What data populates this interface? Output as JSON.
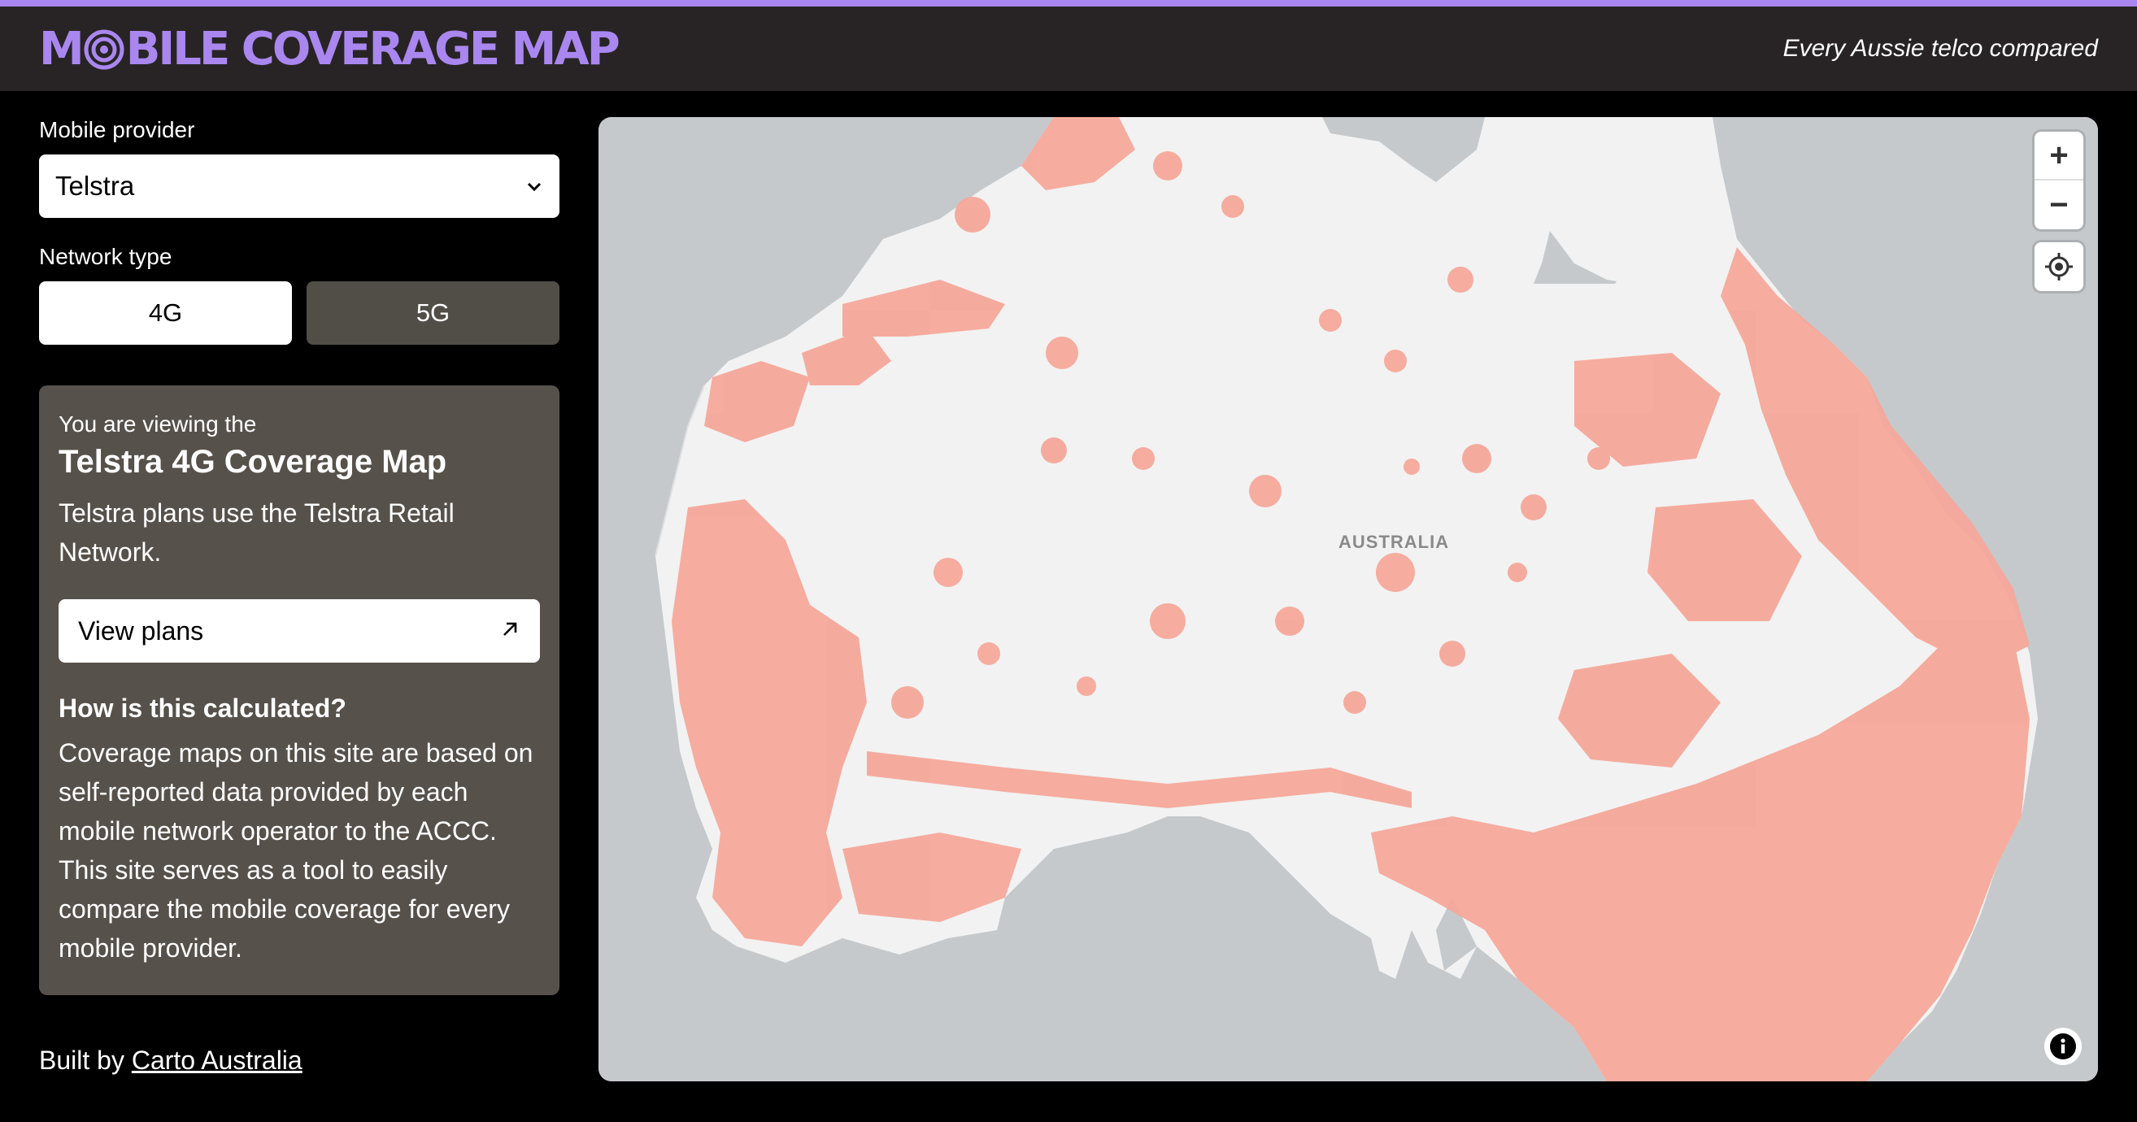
{
  "header": {
    "logo_text_before": "M",
    "logo_text_after": "BILE COVERAGE MAP",
    "tagline": "Every Aussie telco compared",
    "accent_color": "#a987ef"
  },
  "sidebar": {
    "provider_label": "Mobile provider",
    "provider_selected": "Telstra",
    "network_label": "Network type",
    "network_options": [
      "4G",
      "5G"
    ],
    "network_selected": "4G"
  },
  "info_card": {
    "viewing": "You are viewing the",
    "title": "Telstra 4G Coverage Map",
    "description": "Telstra plans use the Telstra Retail Network.",
    "plans_button": "View plans",
    "plans_icon": "arrow-up-right-icon",
    "calc_heading": "How is this calculated?",
    "calc_body": "Coverage maps on this site are based on self-reported data provided by each mobile network operator to the ACCC. This site serves as a tool to easily compare the mobile coverage for every mobile provider."
  },
  "footer": {
    "built_by": "Built by ",
    "link_text": "Carto Australia"
  },
  "map": {
    "place_label": "AUSTRALIA",
    "coverage_color": "#f5a89a",
    "land_color": "#f2f2f2",
    "water_color": "#c5c9cb",
    "zoom_in": "+",
    "zoom_out": "−",
    "locate_icon": "crosshair-icon",
    "attribution_icon": "info-icon"
  }
}
